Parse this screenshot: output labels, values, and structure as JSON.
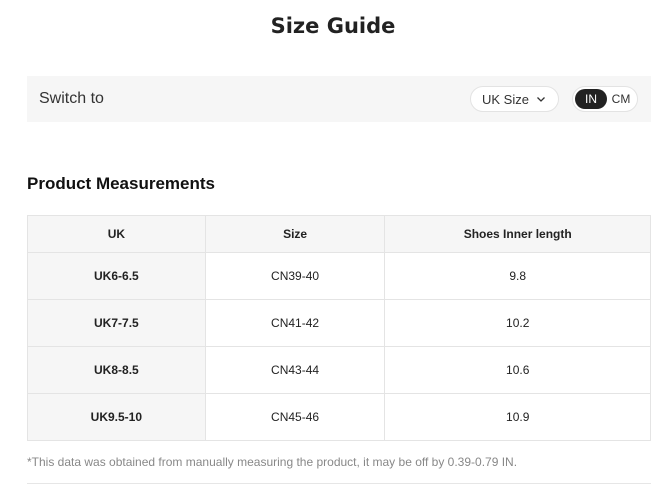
{
  "page": {
    "title": "Size Guide"
  },
  "switch_bar": {
    "label": "Switch to",
    "size_system": {
      "selected": "UK Size",
      "icon": "chevron-down-icon"
    },
    "unit_toggle": {
      "options": [
        "IN",
        "CM"
      ],
      "selected": "IN"
    }
  },
  "measurements": {
    "title": "Product Measurements",
    "columns": [
      "UK",
      "Size",
      "Shoes Inner length"
    ],
    "rows": [
      [
        "UK6-6.5",
        "CN39-40",
        "9.8"
      ],
      [
        "UK7-7.5",
        "CN41-42",
        "10.2"
      ],
      [
        "UK8-8.5",
        "CN43-44",
        "10.6"
      ],
      [
        "UK9.5-10",
        "CN45-46",
        "10.9"
      ]
    ]
  },
  "footnote": "*This data was obtained from manually measuring the product, it may be off by 0.39-0.79 IN.",
  "colors": {
    "active_toggle": "#222222",
    "panel_bg": "#f6f6f6",
    "border": "#e4e4e4",
    "muted_text": "#888888"
  }
}
